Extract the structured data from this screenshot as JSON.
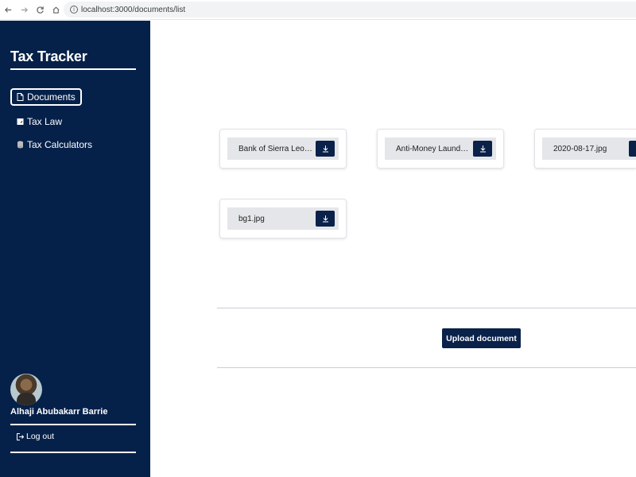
{
  "browser": {
    "url": "localhost:3000/documents/list"
  },
  "sidebar": {
    "brand": "Tax Tracker",
    "items": [
      {
        "label": "Documents",
        "icon": "document-icon",
        "active": true
      },
      {
        "label": "Tax Law",
        "icon": "note-icon",
        "active": false
      },
      {
        "label": "Tax Calculators",
        "icon": "coins-icon",
        "active": false
      }
    ],
    "user_name": "Alhaji Abubakarr Barrie",
    "logout_label": "Log out"
  },
  "documents": [
    {
      "name": "Bank of Sierra Leone.pdf"
    },
    {
      "name": "Anti-Money Laundering.pdf"
    },
    {
      "name": "2020-08-17.jpg"
    },
    {
      "name": "bg1.jpg"
    }
  ],
  "upload_label": "Upload document",
  "colors": {
    "sidebar_bg": "#062149",
    "button_bg": "#0a2149",
    "card_inner_bg": "#e5e6e9"
  }
}
